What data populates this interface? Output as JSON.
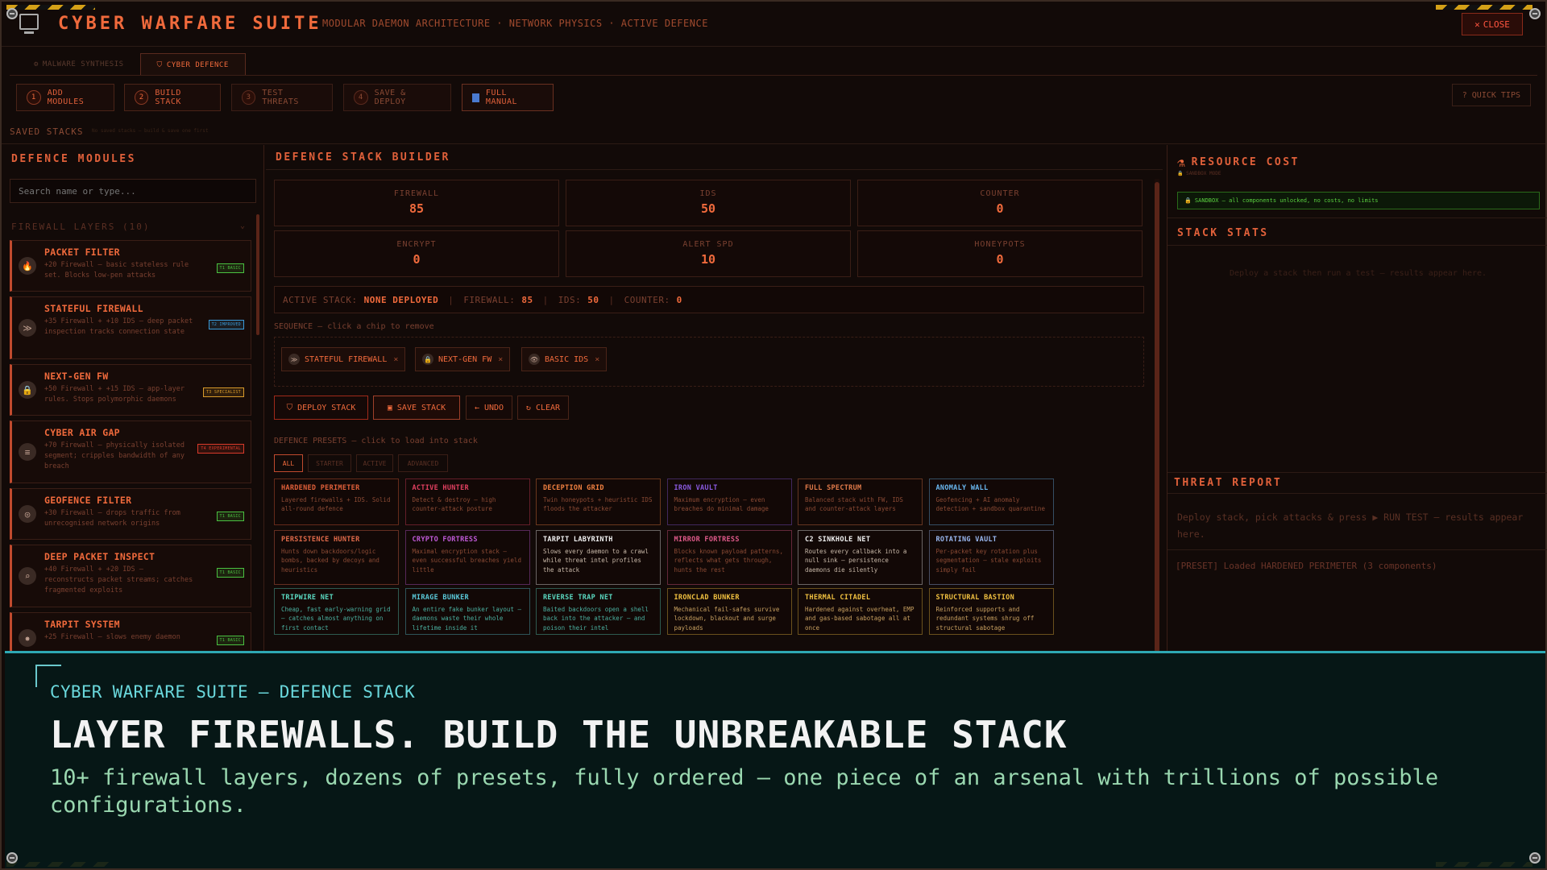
{
  "app": {
    "title": "CYBER WARFARE SUITE",
    "subtitle": "MODULAR DAEMON ARCHITECTURE · NETWORK PHYSICS · ACTIVE DEFENCE",
    "close_label": "CLOSE"
  },
  "tabs": [
    {
      "icon": "⚙",
      "label": "MALWARE SYNTHESIS"
    },
    {
      "icon": "⛉",
      "label": "CYBER DEFENCE"
    }
  ],
  "toolbar": {
    "steps": [
      {
        "num": "1",
        "label": "ADD MODULES"
      },
      {
        "num": "2",
        "label": "BUILD STACK"
      },
      {
        "num": "3",
        "label": "TEST THREATS"
      },
      {
        "num": "4",
        "label": "SAVE & DEPLOY"
      }
    ],
    "manual_label": "FULL MANUAL",
    "tips_label": "? QUICK TIPS"
  },
  "saved_stacks": {
    "label": "SAVED STACKS",
    "note": "No saved stacks — build & save one first"
  },
  "modules_panel": {
    "title": "DEFENCE MODULES",
    "search_placeholder": "Search name or type...",
    "category": "FIREWALL LAYERS (10)",
    "modules": [
      {
        "name": "PACKET FILTER",
        "icon": "🔥",
        "desc": "+20 Firewall — basic stateless rule set. Blocks low-pen attacks",
        "tier": "T1 BASIC",
        "tier_color": "#4ac040"
      },
      {
        "name": "STATEFUL FIREWALL",
        "icon": "≫",
        "desc": "+35 Firewall + +10 IDS — deep packet inspection tracks connection state",
        "tier": "T2 IMPROVED",
        "tier_color": "#3a9ad8"
      },
      {
        "name": "NEXT-GEN FW",
        "icon": "🔒",
        "desc": "+50 Firewall + +15 IDS — app-layer rules. Stops polymorphic daemons",
        "tier": "T3 SPECIALIST",
        "tier_color": "#d89a2a"
      },
      {
        "name": "CYBER AIR GAP",
        "icon": "≡",
        "desc": "+70 Firewall — physically isolated segment; cripples bandwidth of any breach",
        "tier": "T4 EXPERIMENTAL",
        "tier_color": "#d83a2a"
      },
      {
        "name": "GEOFENCE FILTER",
        "icon": "◎",
        "desc": "+30 Firewall — drops traffic from unrecognised network origins",
        "tier": "T1 BASIC",
        "tier_color": "#4ac040"
      },
      {
        "name": "DEEP PACKET INSPECT",
        "icon": "⌕",
        "desc": "+40 Firewall + +20 IDS — reconstructs packet streams; catches fragmented exploits",
        "tier": "T1 BASIC",
        "tier_color": "#4ac040"
      },
      {
        "name": "TARPIT SYSTEM",
        "icon": "✸",
        "desc": "+25 Firewall — slows enemy daemon",
        "tier": "T1 BASIC",
        "tier_color": "#4ac040"
      }
    ]
  },
  "builder": {
    "title": "DEFENCE STACK BUILDER",
    "stats": [
      {
        "label": "FIREWALL",
        "value": "85"
      },
      {
        "label": "IDS",
        "value": "50"
      },
      {
        "label": "COUNTER",
        "value": "0"
      },
      {
        "label": "ENCRYPT",
        "value": "0"
      },
      {
        "label": "ALERT SPD",
        "value": "10"
      },
      {
        "label": "HONEYPOTS",
        "value": "0"
      }
    ],
    "active_stack": {
      "label": "ACTIVE STACK:",
      "value": "NONE DEPLOYED",
      "fw_label": "FIREWALL:",
      "fw_value": "85",
      "ids_label": "IDS:",
      "ids_value": "50",
      "counter_label": "COUNTER:",
      "counter_value": "0"
    },
    "sequence_label": "SEQUENCE — click a chip to remove",
    "chips": [
      {
        "icon": "≫",
        "label": "STATEFUL FIREWALL"
      },
      {
        "icon": "🔒",
        "label": "NEXT-GEN FW"
      },
      {
        "icon": "👁",
        "label": "BASIC IDS"
      }
    ],
    "actions": {
      "deploy": "DEPLOY STACK",
      "save": "SAVE STACK",
      "undo": "← UNDO",
      "clear": "CLEAR"
    },
    "presets_label": "DEFENCE PRESETS — click to load into stack",
    "filters": [
      "ALL",
      "STARTER",
      "ACTIVE",
      "ADVANCED"
    ],
    "presets": [
      {
        "name": "HARDENED PERIMETER",
        "desc": "Layered firewalls + IDS. Solid all-round defence",
        "color": "#e0603a"
      },
      {
        "name": "ACTIVE HUNTER",
        "desc": "Detect & destroy — high counter-attack posture",
        "color": "#e04060"
      },
      {
        "name": "DECEPTION GRID",
        "desc": "Twin honeypots + heuristic IDS floods the attacker",
        "color": "#f08040"
      },
      {
        "name": "IRON VAULT",
        "desc": "Maximum encryption — even breaches do minimal damage",
        "color": "#8a5ae0"
      },
      {
        "name": "FULL SPECTRUM",
        "desc": "Balanced stack with FW, IDS and counter-attack layers",
        "color": "#e07a4a"
      },
      {
        "name": "ANOMALY WALL",
        "desc": "Geofencing + AI anomaly detection + sandbox quarantine",
        "color": "#6ab8f0"
      },
      {
        "name": "PERSISTENCE HUNTER",
        "desc": "Hunts down backdoors/logic bombs, backed by decoys and heuristics",
        "color": "#e06a4a"
      },
      {
        "name": "CRYPTO FORTRESS",
        "desc": "Maximal encryption stack — even successful breaches yield little",
        "color": "#c05ad8"
      },
      {
        "name": "TARPIT LABYRINTH",
        "desc": "Slows every daemon to a crawl while threat intel profiles the attack",
        "color": "#f0f0f0"
      },
      {
        "name": "MIRROR FORTRESS",
        "desc": "Blocks known payload patterns, reflects what gets through, hunts the rest",
        "color": "#e05a8a"
      },
      {
        "name": "C2 SINKHOLE NET",
        "desc": "Routes every callback into a null sink — persistence daemons die silently",
        "color": "#f0f0f0"
      },
      {
        "name": "ROTATING VAULT",
        "desc": "Per-packet key rotation plus segmentation — stale exploits simply fail",
        "color": "#9ab8f0"
      },
      {
        "name": "TRIPWIRE NET",
        "desc": "Cheap, fast early-warning grid — catches almost anything on first contact",
        "color": "#5ad8c0"
      },
      {
        "name": "MIRAGE BUNKER",
        "desc": "An entire fake bunker layout — daemons waste their whole lifetime inside it",
        "color": "#5ac8d8"
      },
      {
        "name": "REVERSE TRAP NET",
        "desc": "Baited backdoors open a shell back into the attacker — and poison their intel",
        "color": "#5ad8c0"
      },
      {
        "name": "IRONCLAD BUNKER",
        "desc": "Mechanical fail-safes survive lockdown, blackout and surge payloads",
        "color": "#f0c040"
      },
      {
        "name": "THERMAL CITADEL",
        "desc": "Hardened against overheat, EMP and gas-based sabotage all at once",
        "color": "#f0c040"
      },
      {
        "name": "STRUCTURAL BASTION",
        "desc": "Reinforced supports and redundant systems shrug off structural sabotage",
        "color": "#f0c040"
      }
    ]
  },
  "right_panel": {
    "cost_title": "RESOURCE COST",
    "cost_sub": "🔒 SANDBOX MODE",
    "sandbox_note": "🔒 SANDBOX — all components unlocked, no costs, no limits",
    "stats_title": "STACK STATS",
    "stats_empty": "Deploy a stack then run a test — results appear here.",
    "report_title": "THREAT REPORT",
    "report_text": "Deploy stack, pick attacks & press ▶ RUN TEST — results appear here.",
    "report_log": "[PRESET] Loaded HARDENED PERIMETER (3 components)"
  },
  "banner": {
    "kicker": "CYBER WARFARE SUITE — DEFENCE STACK",
    "headline": "LAYER FIREWALLS. BUILD THE UNBREAKABLE STACK",
    "subline": "10+ firewall layers, dozens of presets, fully ordered — one piece of an arsenal with trillions of possible configurations."
  }
}
